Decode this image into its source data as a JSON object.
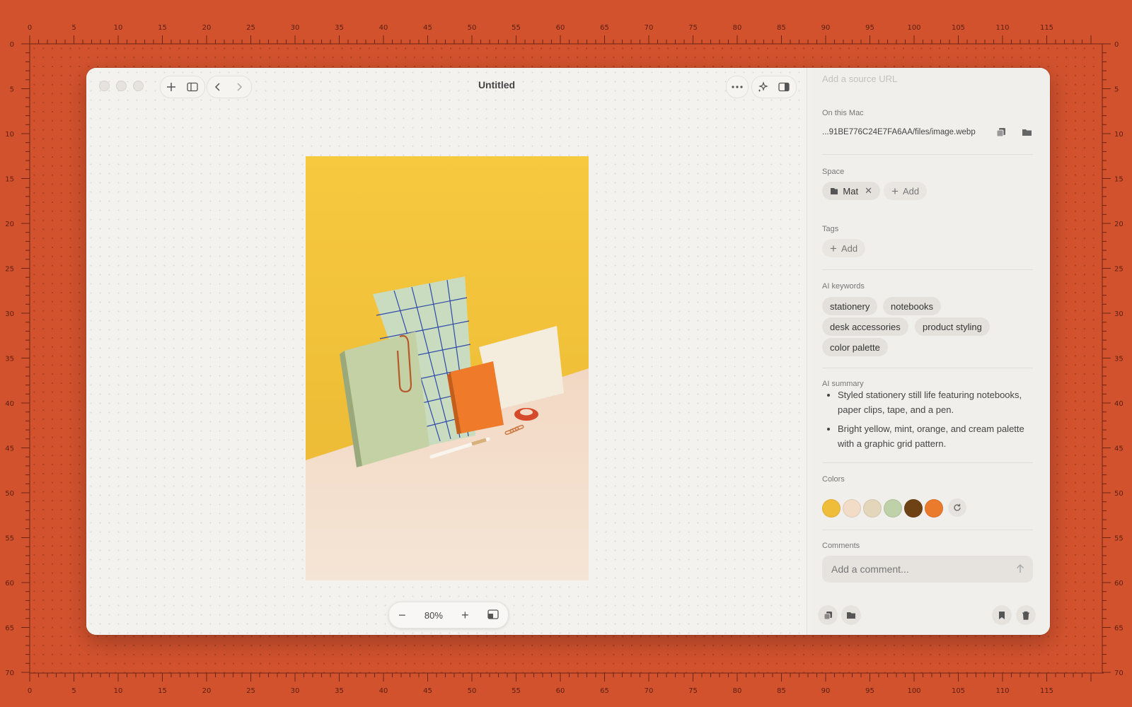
{
  "ruler": {
    "h_labels": [
      "0",
      "5",
      "10",
      "15",
      "20",
      "25",
      "30",
      "35",
      "40",
      "45",
      "50",
      "55",
      "60",
      "65",
      "70",
      "75",
      "80",
      "85",
      "90",
      "95",
      "100",
      "105",
      "110",
      "115"
    ],
    "v_labels": [
      "0",
      "5",
      "10",
      "15",
      "20",
      "25",
      "30",
      "35",
      "40",
      "45",
      "50",
      "55",
      "60",
      "65",
      "70"
    ]
  },
  "window": {
    "title": "Untitled"
  },
  "zoom": {
    "level": "80%"
  },
  "panel": {
    "source_url_placeholder": "Add a source URL",
    "on_this_mac_label": "On this Mac",
    "file_path": "...91BE776C24E7FA6AA/files/image.webp",
    "space_label": "Space",
    "space_chip": "Mat",
    "add_label": "Add",
    "tags_label": "Tags",
    "ai_keywords_label": "AI keywords",
    "keywords": [
      "stationery",
      "notebooks",
      "desk accessories",
      "product styling",
      "color palette"
    ],
    "ai_summary_label": "AI summary",
    "summary": [
      "Styled stationery still life featuring notebooks, paper clips, tape, and a pen.",
      "Bright yellow, mint, orange, and cream palette with a graphic grid pattern."
    ],
    "colors_label": "Colors",
    "colors": [
      "#f0bd3a",
      "#f2dcc8",
      "#e3d6bb",
      "#bfd1a8",
      "#6e4215",
      "#ea7a2c"
    ],
    "comments_label": "Comments",
    "comment_placeholder": "Add a comment..."
  },
  "icons": {
    "new": "plus-icon",
    "sidebar": "sidebar-icon",
    "back": "chevron-left-icon",
    "forward": "chevron-right-icon",
    "more": "ellipsis-icon",
    "ai": "sparkles-icon",
    "inspector": "inspector-icon"
  }
}
